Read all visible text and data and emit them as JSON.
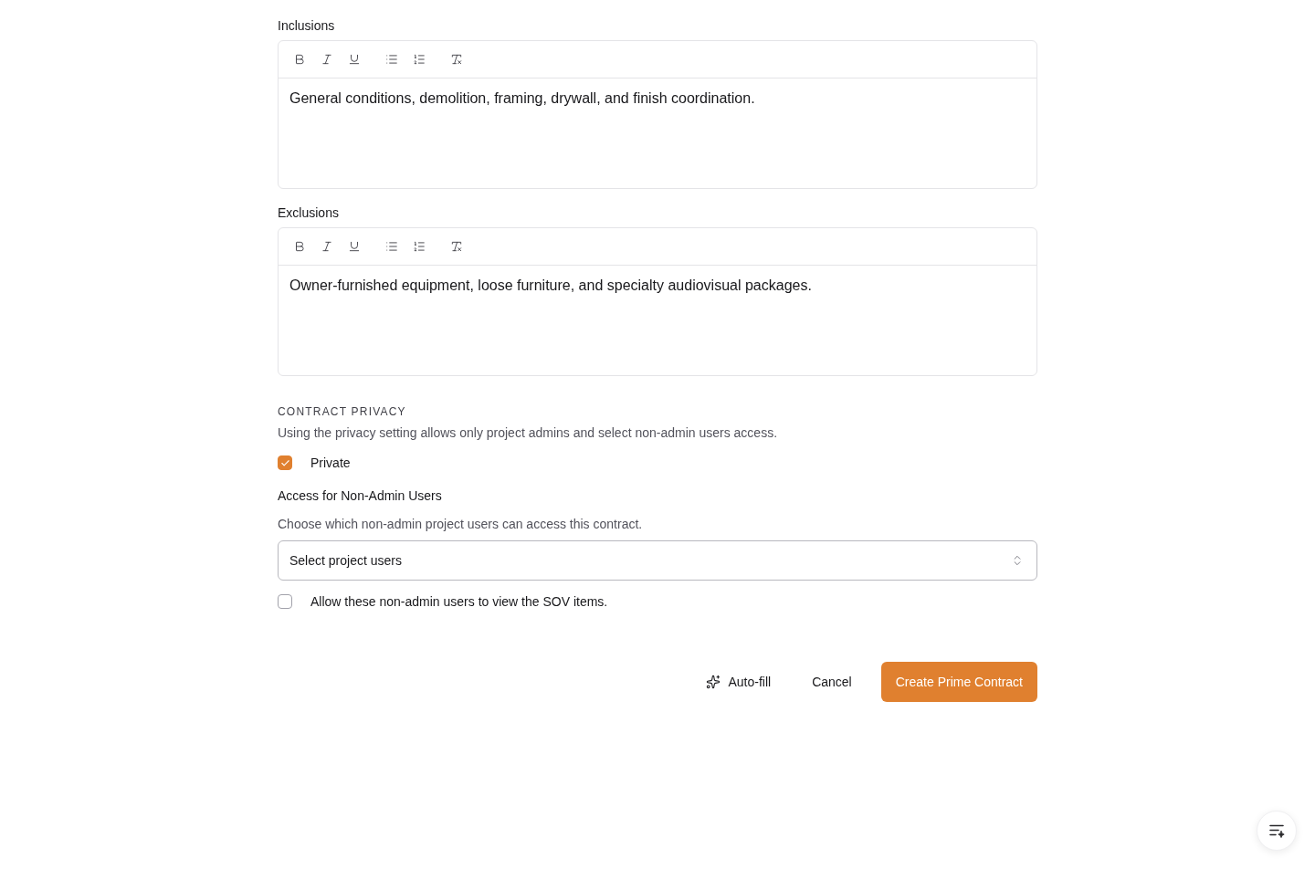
{
  "editors": [
    {
      "label": "Inclusions",
      "text": "General conditions, demolition, framing, drywall, and finish coordination."
    },
    {
      "label": "Exclusions",
      "text": "Owner-furnished equipment, loose furniture, and specialty audiovisual packages."
    }
  ],
  "privacy": {
    "heading": "CONTRACT PRIVACY",
    "description": "Using the privacy setting allows only project admins and select non-admin users access.",
    "private": {
      "label": "Private",
      "checked": true
    }
  },
  "access": {
    "label": "Access for Non-Admin Users",
    "description": "Choose which non-admin project users can access this contract.",
    "select": {
      "placeholder": "Select project users"
    },
    "sov": {
      "label": "Allow these non-admin users to view the SOV items.",
      "checked": false
    }
  },
  "actions": [
    {
      "kind": "autofill",
      "label": "Auto-fill"
    },
    {
      "kind": "ghost",
      "label": "Cancel"
    },
    {
      "kind": "primary",
      "label": "Create Prime Contract"
    }
  ]
}
